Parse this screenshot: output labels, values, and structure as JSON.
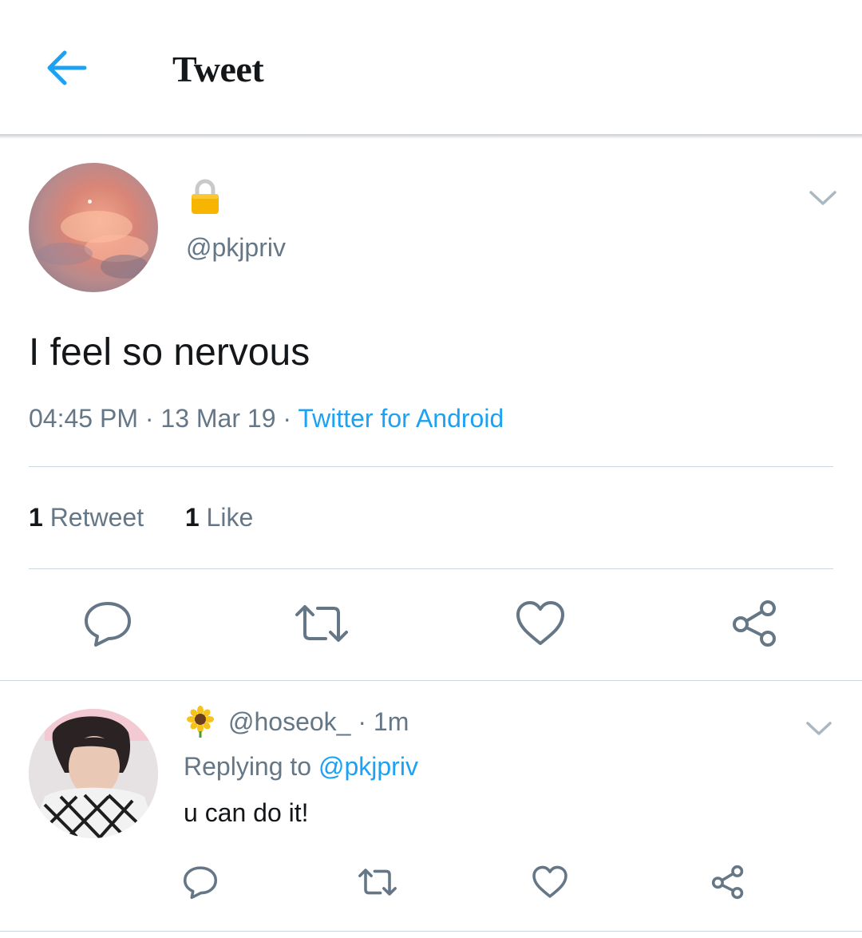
{
  "header": {
    "title": "Tweet"
  },
  "tweet": {
    "handle": "@pkjpriv",
    "text": "I feel so nervous",
    "time": "04:45 PM",
    "date": "13 Mar 19",
    "sep": "·",
    "source": "Twitter for Android",
    "retweet_count": "1",
    "retweet_label": "Retweet",
    "like_count": "1",
    "like_label": "Like"
  },
  "reply": {
    "handle": "@hoseok_",
    "sep": "·",
    "time": "1m",
    "replying_prefix": "Replying to",
    "replying_handle": "@pkjpriv",
    "text": "u can do it!"
  },
  "colors": {
    "accent": "#1da1f2",
    "icon": "#657786",
    "divider": "#ccd6dd"
  },
  "icons": [
    "back-arrow-icon",
    "lock-icon",
    "chevron-down-icon",
    "reply-icon",
    "retweet-icon",
    "like-icon",
    "share-icon",
    "sunflower-icon"
  ]
}
